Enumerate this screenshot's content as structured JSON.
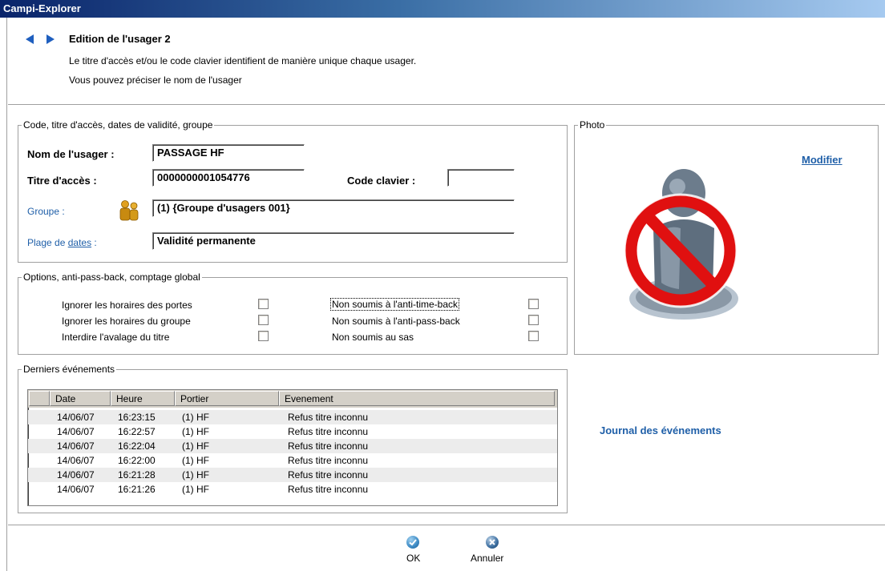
{
  "window": {
    "title": "Campi-Explorer"
  },
  "header": {
    "title": "Edition de l'usager 2",
    "line1": "Le titre d'accès et/ou le code clavier identifient de manière unique chaque usager.",
    "line2": "Vous pouvez préciser le nom de l'usager"
  },
  "identity": {
    "legend": "Code, titre d'accès, dates de validité, groupe",
    "name_label": "Nom de l'usager :",
    "name_value": "PASSAGE HF",
    "title_label": "Titre d'accès :",
    "title_value": "0000000001054776",
    "code_label": "Code clavier :",
    "code_value": "",
    "group_label": "Groupe :",
    "group_value": "(1) {Groupe d'usagers 001}",
    "dates_label_pre": "Plage de ",
    "dates_label_link": "dates",
    "dates_label_post": " :",
    "dates_value": "Validité permanente"
  },
  "options": {
    "legend": "Options, anti-pass-back, comptage global",
    "left": [
      {
        "label": "Ignorer les horaires des portes",
        "checked": false
      },
      {
        "label": "Ignorer les horaires du groupe",
        "checked": false
      },
      {
        "label": "Interdire l'avalage du titre",
        "checked": false
      }
    ],
    "right": [
      {
        "label": "Non soumis à l'anti-time-back",
        "checked": false
      },
      {
        "label": "Non soumis à l'anti-pass-back",
        "checked": false
      },
      {
        "label": "Non soumis au sas",
        "checked": false
      }
    ]
  },
  "photo": {
    "legend": "Photo",
    "modify_link": "Modifier",
    "icon": "no-photo-icon"
  },
  "events": {
    "legend": "Derniers événements",
    "columns": [
      "Date",
      "Heure",
      "Portier",
      "Evenement"
    ],
    "rows": [
      [
        "14/06/07",
        "16:23:15",
        "(1) HF",
        "Refus titre inconnu"
      ],
      [
        "14/06/07",
        "16:22:57",
        "(1) HF",
        "Refus titre inconnu"
      ],
      [
        "14/06/07",
        "16:22:04",
        "(1) HF",
        "Refus titre inconnu"
      ],
      [
        "14/06/07",
        "16:22:00",
        "(1) HF",
        "Refus titre inconnu"
      ],
      [
        "14/06/07",
        "16:21:28",
        "(1) HF",
        "Refus titre inconnu"
      ],
      [
        "14/06/07",
        "16:21:26",
        "(1) HF",
        "Refus titre inconnu"
      ]
    ],
    "journal_link": "Journal des événements"
  },
  "buttons": {
    "ok": "OK",
    "cancel": "Annuler"
  },
  "colors": {
    "accent": "#1f5fa8",
    "titlebar": "#0a246a",
    "ok": "#3c8ac4",
    "cancel": "#3c6ea0"
  }
}
